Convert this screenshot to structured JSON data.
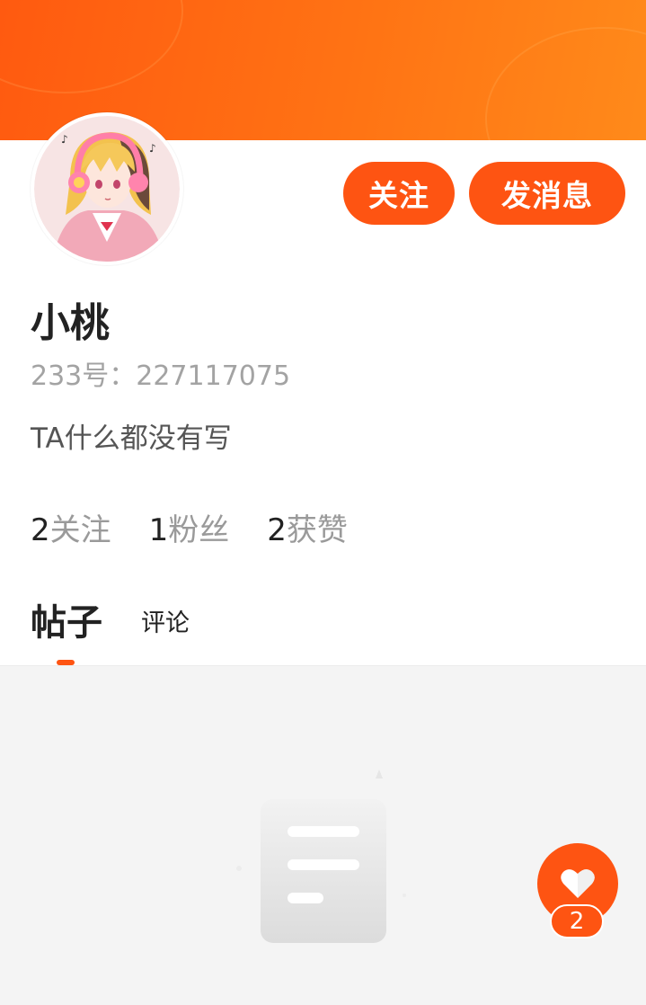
{
  "colors": {
    "accent": "#fe5412",
    "banner_start": "#ff5a10",
    "banner_end": "#ff8a1a",
    "content_bg": "#f4f4f4"
  },
  "profile": {
    "avatar_icon": "anime-girl-avatar",
    "name": "小桃",
    "uid": "233号：227117075",
    "bio": "TA什么都没有写"
  },
  "actions": {
    "follow_label": "关注",
    "message_label": "发消息"
  },
  "stats": [
    {
      "value": "2",
      "label": "关注"
    },
    {
      "value": "1",
      "label": "粉丝"
    },
    {
      "value": "2",
      "label": "获赞"
    }
  ],
  "tabs": [
    {
      "label": "帖子",
      "active": true
    },
    {
      "label": "评论",
      "active": false
    }
  ],
  "empty_state": {
    "icon": "empty-document-icon"
  },
  "like": {
    "icon": "heart-icon",
    "count": "2"
  }
}
